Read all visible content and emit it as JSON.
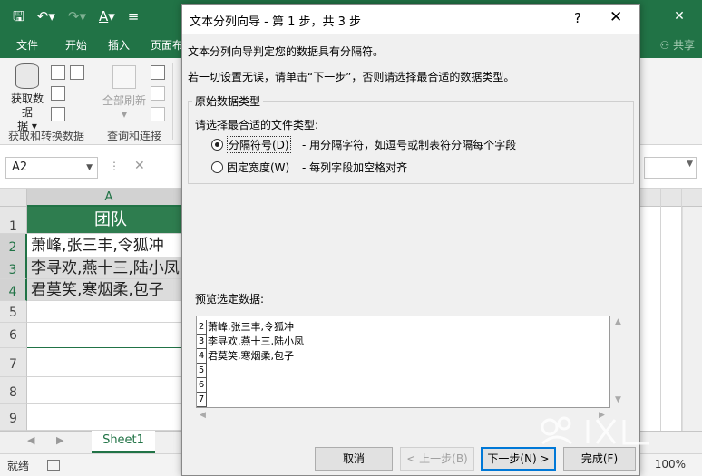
{
  "excel": {
    "quick_access": {
      "save_icon": "save-icon",
      "undo_icon": "undo-icon",
      "redo_icon": "redo-icon",
      "font_color_icon": "font-color-icon",
      "customize_icon": "customize-qat-icon"
    },
    "window_controls": {
      "restore": "restore-icon",
      "close": "close-icon"
    },
    "tabs": [
      {
        "label": "文件"
      },
      {
        "label": "开始"
      },
      {
        "label": "插入"
      },
      {
        "label": "页面布"
      }
    ],
    "share_label": "共享",
    "ribbon": {
      "get_data_label": "获取数据",
      "get_data_label2": "据",
      "group_get_transform": "获取和转换数据",
      "refresh_all_label": "全部刷新",
      "group_queries": "查询和连接"
    },
    "name_box": "A2",
    "formula_bar": {
      "dots": "⋮",
      "cancel": "✕"
    },
    "column_header": "A",
    "rows": [
      {
        "num": "1",
        "value": "团队"
      },
      {
        "num": "2",
        "value": "萧峰,张三丰,令狐冲"
      },
      {
        "num": "3",
        "value": "李寻欢,燕十三,陆小凤"
      },
      {
        "num": "4",
        "value": "君莫笑,寒烟柔,包子"
      },
      {
        "num": "5",
        "value": ""
      },
      {
        "num": "6",
        "value": ""
      },
      {
        "num": "7",
        "value": ""
      },
      {
        "num": "8",
        "value": ""
      },
      {
        "num": "9",
        "value": ""
      }
    ],
    "sheet_tab": "Sheet1",
    "status": "就绪",
    "zoom": "100%"
  },
  "dialog": {
    "title": "文本分列向导 - 第 1 步，共 3 步",
    "help": "?",
    "close": "✕",
    "line1": "文本分列向导判定您的数据具有分隔符。",
    "line2": "若一切设置无误，请单击“下一步”，否则请选择最合适的数据类型。",
    "group_title": "原始数据类型",
    "group_prompt": "请选择最合适的文件类型:",
    "options": [
      {
        "label": "分隔符号(D)",
        "desc": "- 用分隔字符，如逗号或制表符分隔每个字段",
        "selected": true
      },
      {
        "label": "固定宽度(W)",
        "desc": "- 每列字段加空格对齐",
        "selected": false
      }
    ],
    "preview_label": "预览选定数据:",
    "preview_rows": [
      {
        "num": "2",
        "text": "萧峰,张三丰,令狐冲"
      },
      {
        "num": "3",
        "text": "李寻欢,燕十三,陆小凤"
      },
      {
        "num": "4",
        "text": "君莫笑,寒烟柔,包子"
      },
      {
        "num": "5",
        "text": ""
      },
      {
        "num": "6",
        "text": ""
      },
      {
        "num": "7",
        "text": ""
      }
    ],
    "buttons": {
      "cancel": "取消",
      "back": "< 上一步(B)",
      "next": "下一步(N) >",
      "finish": "完成(F)"
    }
  },
  "colors": {
    "excel_green": "#217346",
    "dialog_bg": "#f0f0f0",
    "focus_blue": "#0078d7"
  }
}
